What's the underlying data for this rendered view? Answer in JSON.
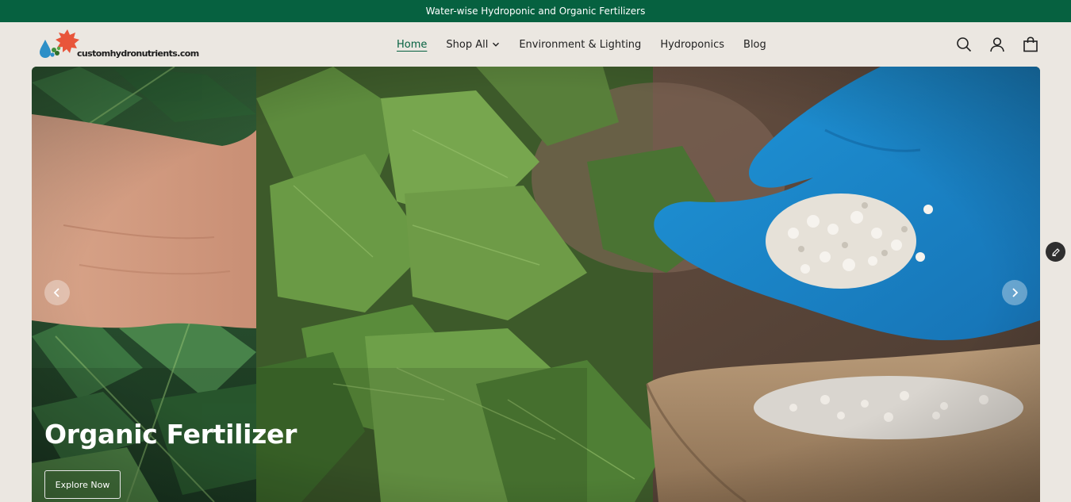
{
  "announcement": "Water-wise Hydroponic and Organic Fertilizers",
  "brand": {
    "logo_text": "customhydronutrients.com",
    "colors": {
      "primary": "#066140",
      "sun": "#e8553a",
      "drop": "#2d8fc7"
    }
  },
  "nav": [
    {
      "label": "Home",
      "active": true
    },
    {
      "label": "Shop All",
      "has_dropdown": true
    },
    {
      "label": "Environment & Lighting"
    },
    {
      "label": "Hydroponics"
    },
    {
      "label": "Blog"
    }
  ],
  "header_icons": [
    "search-icon",
    "account-icon",
    "cart-icon"
  ],
  "hero": {
    "title": "Organic Fertilizer",
    "cta_label": "Explore Now",
    "prev_icon": "chevron-left-icon",
    "next_icon": "chevron-right-icon"
  },
  "floating": {
    "icon": "pencil-icon"
  }
}
